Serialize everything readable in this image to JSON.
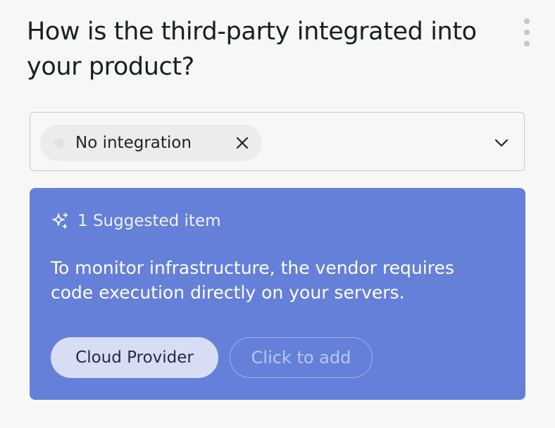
{
  "question": {
    "title": "How is the third-party integrated into your product?"
  },
  "icons": {
    "menu": "kebab-menu-icon",
    "chip_close": "close-icon",
    "dropdown": "chevron-down-icon",
    "suggestion": "sparkle-icon"
  },
  "select": {
    "selected_chip_label": "No integration"
  },
  "suggestion": {
    "count_label": "1 Suggested item",
    "description": "To monitor infrastructure, the vendor requires code execution directly on your servers.",
    "suggested_option": "Cloud Provider",
    "add_action": "Click to add"
  },
  "colors": {
    "background": "#f7f7f5",
    "card_accent": "#6580d8",
    "chip_background": "#ececec",
    "suggested_pill": "#d6ddf5"
  }
}
